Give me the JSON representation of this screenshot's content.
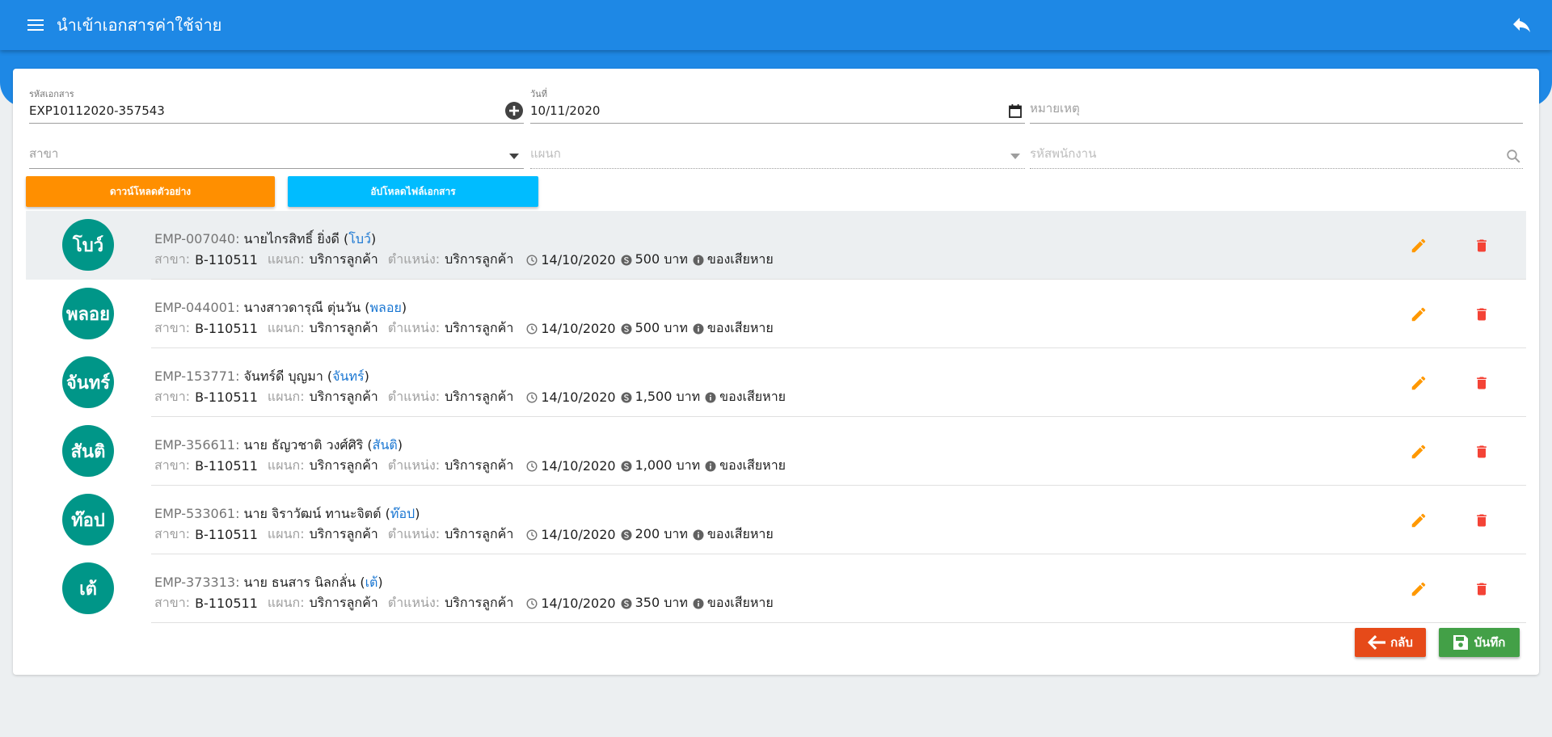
{
  "header": {
    "title": "นำเข้าเอกสารค่าใช้จ่าย",
    "menu_icon": "menu-icon",
    "back_icon": "reply-icon"
  },
  "form": {
    "doc_code": {
      "label": "รหัสเอกสาร",
      "value": "EXP10112020-357543"
    },
    "date": {
      "label": "วันที่",
      "value": "10/11/2020"
    },
    "note": {
      "placeholder": "หมายเหตุ"
    },
    "branch": {
      "placeholder": "สาขา"
    },
    "department": {
      "placeholder": "แผนก"
    },
    "employee_code": {
      "placeholder": "รหัสพนักงาน"
    }
  },
  "buttons": {
    "download_template": "ดาวน์โหลดตัวอย่าง",
    "upload_document": "อัปโหลดไฟล์เอกสาร",
    "back": "กลับ",
    "save": "บันทึก"
  },
  "labels": {
    "branch": "สาขา:",
    "department": "แผนก:",
    "position": "ตำแหน่ง:"
  },
  "colors": {
    "primary": "#1e88e5",
    "avatar": "#009688",
    "download": "#ff8f00",
    "upload": "#00bcff",
    "edit": "#ff9800",
    "delete": "#f44336",
    "back": "#e64a19",
    "save": "#43a047"
  },
  "rows": [
    {
      "avatar": "โบว์",
      "code": "EMP-007040:",
      "name": "นายไกรสิทธิ์ ยิ่งดี",
      "nick": "โบว์",
      "branch": "B-110511",
      "department": "บริการลูกค้า",
      "position": "บริการลูกค้า",
      "date": "14/10/2020",
      "amount": "500 บาท",
      "reason": "ของเสียหาย"
    },
    {
      "avatar": "พลอย",
      "code": "EMP-044001:",
      "name": "นางสาวดารุณี ตุ่นวัน",
      "nick": "พลอย",
      "branch": "B-110511",
      "department": "บริการลูกค้า",
      "position": "บริการลูกค้า",
      "date": "14/10/2020",
      "amount": "500 บาท",
      "reason": "ของเสียหาย"
    },
    {
      "avatar": "จันทร์",
      "code": "EMP-153771:",
      "name": "จันทร์ดี บุญมา",
      "nick": "จันทร์",
      "branch": "B-110511",
      "department": "บริการลูกค้า",
      "position": "บริการลูกค้า",
      "date": "14/10/2020",
      "amount": "1,500 บาท",
      "reason": "ของเสียหาย"
    },
    {
      "avatar": "สันติ",
      "code": "EMP-356611:",
      "name": "นาย ธัญวชาติ วงศ์ศิริ",
      "nick": "สันติ",
      "branch": "B-110511",
      "department": "บริการลูกค้า",
      "position": "บริการลูกค้า",
      "date": "14/10/2020",
      "amount": "1,000 บาท",
      "reason": "ของเสียหาย"
    },
    {
      "avatar": "ท๊อป",
      "code": "EMP-533061:",
      "name": "นาย จิราวัฒน์ ทานะจิตต์",
      "nick": "ท๊อป",
      "branch": "B-110511",
      "department": "บริการลูกค้า",
      "position": "บริการลูกค้า",
      "date": "14/10/2020",
      "amount": "200 บาท",
      "reason": "ของเสียหาย"
    },
    {
      "avatar": "เต้",
      "code": "EMP-373313:",
      "name": "นาย ธนสาร นิลกลั่น",
      "nick": "เต้",
      "branch": "B-110511",
      "department": "บริการลูกค้า",
      "position": "บริการลูกค้า",
      "date": "14/10/2020",
      "amount": "350 บาท",
      "reason": "ของเสียหาย"
    }
  ]
}
